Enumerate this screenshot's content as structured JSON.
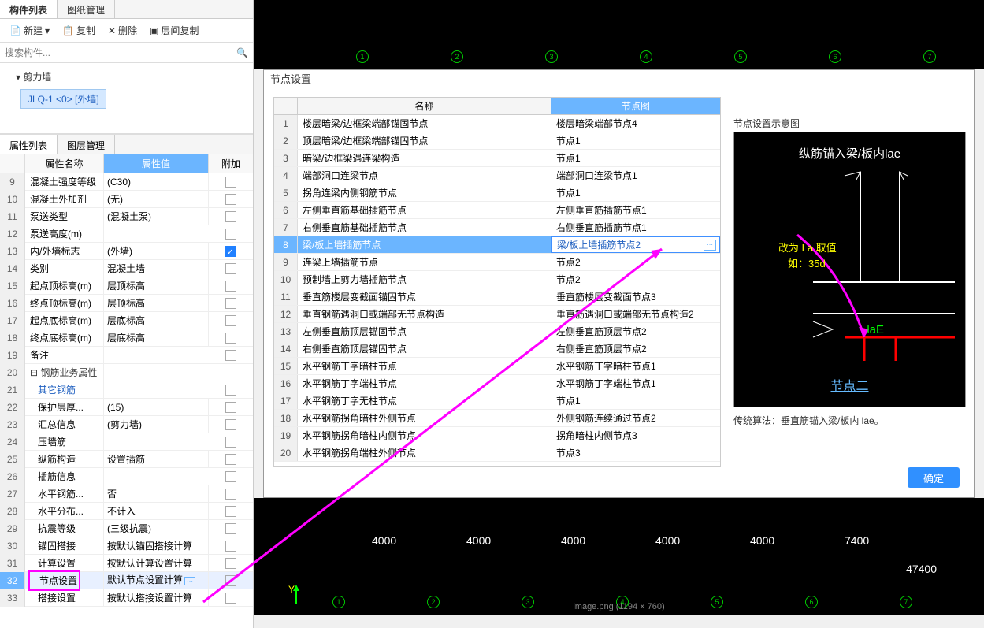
{
  "topTabs": {
    "tab1": "构件列表",
    "tab2": "图纸管理"
  },
  "toolbar": {
    "new": "新建",
    "copy": "复制",
    "del": "删除",
    "layercopy": "层间复制"
  },
  "search": {
    "placeholder": "搜索构件..."
  },
  "tree": {
    "root": "剪力墙",
    "child": "JLQ-1 <0> [外墙]"
  },
  "propTabs": {
    "t1": "属性列表",
    "t2": "图层管理"
  },
  "propHeader": {
    "name": "属性名称",
    "val": "属性值",
    "ext": "附加"
  },
  "props": [
    {
      "n": 9,
      "name": "混凝土强度等级",
      "val": "(C30)",
      "chk": false
    },
    {
      "n": 10,
      "name": "混凝土外加剂",
      "val": "(无)",
      "chk": false
    },
    {
      "n": 11,
      "name": "泵送类型",
      "val": "(混凝土泵)",
      "chk": false
    },
    {
      "n": 12,
      "name": "泵送高度(m)",
      "val": "",
      "chk": false
    },
    {
      "n": 13,
      "name": "内/外墙标志",
      "val": "(外墙)",
      "chk": true
    },
    {
      "n": 14,
      "name": "类别",
      "val": "混凝土墙",
      "chk": false
    },
    {
      "n": 15,
      "name": "起点顶标高(m)",
      "val": "层顶标高",
      "chk": false
    },
    {
      "n": 16,
      "name": "终点顶标高(m)",
      "val": "层顶标高",
      "chk": false
    },
    {
      "n": 17,
      "name": "起点底标高(m)",
      "val": "层底标高",
      "chk": false
    },
    {
      "n": 18,
      "name": "终点底标高(m)",
      "val": "层底标高",
      "chk": false
    },
    {
      "n": 19,
      "name": "备注",
      "val": "",
      "chk": false
    },
    {
      "n": 20,
      "name": "钢筋业务属性",
      "val": "",
      "group": true
    },
    {
      "n": 21,
      "name": "其它钢筋",
      "val": "",
      "link": true,
      "chk": false,
      "indent": true
    },
    {
      "n": 22,
      "name": "保护层厚...",
      "val": "(15)",
      "chk": false,
      "indent": true
    },
    {
      "n": 23,
      "name": "汇总信息",
      "val": "(剪力墙)",
      "chk": false,
      "indent": true
    },
    {
      "n": 24,
      "name": "压墙筋",
      "val": "",
      "chk": false,
      "indent": true
    },
    {
      "n": 25,
      "name": "纵筋构造",
      "val": "设置插筋",
      "chk": false,
      "indent": true
    },
    {
      "n": 26,
      "name": "插筋信息",
      "val": "",
      "chk": false,
      "indent": true
    },
    {
      "n": 27,
      "name": "水平钢筋...",
      "val": "否",
      "chk": false,
      "indent": true
    },
    {
      "n": 28,
      "name": "水平分布...",
      "val": "不计入",
      "chk": false,
      "indent": true
    },
    {
      "n": 29,
      "name": "抗震等级",
      "val": "(三级抗震)",
      "chk": false,
      "indent": true
    },
    {
      "n": 30,
      "name": "锚固搭接",
      "val": "按默认锚固搭接计算",
      "chk": false,
      "indent": true
    },
    {
      "n": 31,
      "name": "计算设置",
      "val": "按默认计算设置计算",
      "chk": false,
      "indent": true
    },
    {
      "n": 32,
      "name": "节点设置",
      "val": "默认节点设置计算",
      "chk": false,
      "indent": true,
      "sel": true,
      "hlName": true,
      "more": true
    },
    {
      "n": 33,
      "name": "搭接设置",
      "val": "按默认搭接设置计算",
      "chk": false,
      "indent": true
    }
  ],
  "dialog": {
    "title": "节点设置",
    "thName": "名称",
    "thVal": "节点图",
    "rows": [
      {
        "n": 1,
        "name": "楼层暗梁/边框梁端部锚固节点",
        "val": "楼层暗梁端部节点4"
      },
      {
        "n": 2,
        "name": "顶层暗梁/边框梁端部锚固节点",
        "val": "节点1"
      },
      {
        "n": 3,
        "name": "暗梁/边框梁遇连梁构造",
        "val": "节点1"
      },
      {
        "n": 4,
        "name": "端部洞口连梁节点",
        "val": "端部洞口连梁节点1"
      },
      {
        "n": 5,
        "name": "拐角连梁内侧钢筋节点",
        "val": "节点1"
      },
      {
        "n": 6,
        "name": "左侧垂直筋基础插筋节点",
        "val": "左侧垂直筋插筋节点1"
      },
      {
        "n": 7,
        "name": "右侧垂直筋基础插筋节点",
        "val": "右侧垂直筋插筋节点1"
      },
      {
        "n": 8,
        "name": "梁/板上墙插筋节点",
        "val": "梁/板上墙插筋节点2",
        "sel": true
      },
      {
        "n": 9,
        "name": "连梁上墙插筋节点",
        "val": "节点2"
      },
      {
        "n": 10,
        "name": "预制墙上剪力墙插筋节点",
        "val": "节点2"
      },
      {
        "n": 11,
        "name": "垂直筋楼层变截面锚固节点",
        "val": "垂直筋楼层变截面节点3"
      },
      {
        "n": 12,
        "name": "垂直钢筋遇洞口或端部无节点构造",
        "val": "垂直筋遇洞口或端部无节点构造2"
      },
      {
        "n": 13,
        "name": "左侧垂直筋顶层锚固节点",
        "val": "左侧垂直筋顶层节点2"
      },
      {
        "n": 14,
        "name": "右侧垂直筋顶层锚固节点",
        "val": "右侧垂直筋顶层节点2"
      },
      {
        "n": 15,
        "name": "水平钢筋丁字暗柱节点",
        "val": "水平钢筋丁字暗柱节点1"
      },
      {
        "n": 16,
        "name": "水平钢筋丁字端柱节点",
        "val": "水平钢筋丁字端柱节点1"
      },
      {
        "n": 17,
        "name": "水平钢筋丁字无柱节点",
        "val": "节点1"
      },
      {
        "n": 18,
        "name": "水平钢筋拐角暗柱外侧节点",
        "val": "外侧钢筋连续通过节点2"
      },
      {
        "n": 19,
        "name": "水平钢筋拐角暗柱内侧节点",
        "val": "拐角暗柱内侧节点3"
      },
      {
        "n": 20,
        "name": "水平钢筋拐角端柱外侧节点",
        "val": "节点3"
      }
    ],
    "ok": "确定"
  },
  "preview": {
    "title": "节点设置示意图",
    "t1": "纵筋锚入梁/板内lae",
    "tLabel1": "改为 La 取值",
    "tLabel2": "如：35d",
    "lae": "laE",
    "nodename": "节点二",
    "note": "传统算法：垂直筋锚入梁/板内 lae。"
  },
  "cad": {
    "dims": [
      "4000",
      "4000",
      "4000",
      "4000",
      "4000",
      "7400"
    ],
    "total": "47400",
    "status": "image.png (1194 × 760)",
    "axesTop": [
      "1",
      "2",
      "3",
      "4",
      "5",
      "6",
      "7"
    ],
    "axesBot": [
      "1",
      "2",
      "3",
      "4",
      "5",
      "6",
      "7"
    ]
  }
}
